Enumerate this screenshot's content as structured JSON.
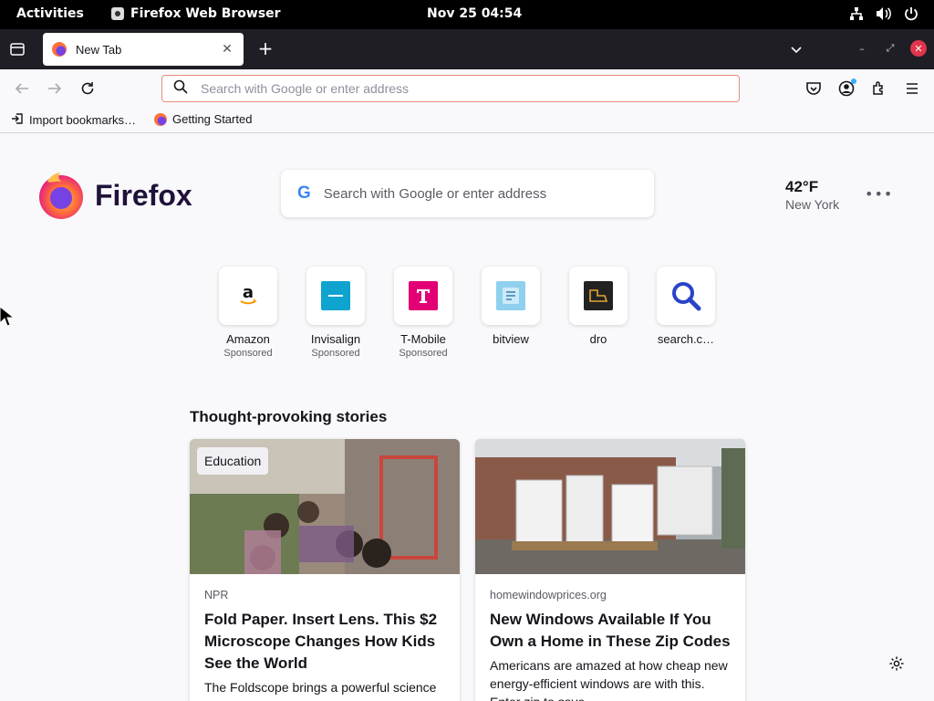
{
  "topbar": {
    "activities": "Activities",
    "app_name": "Firefox Web Browser",
    "clock": "Nov 25  04:54",
    "tray_icons": [
      "network-icon",
      "volume-icon",
      "power-icon"
    ]
  },
  "tabs": [
    {
      "title": "New Tab",
      "active": true
    }
  ],
  "navbar": {
    "url_placeholder": "Search with Google or enter address"
  },
  "bookmarks": [
    {
      "label": "Import bookmarks…",
      "icon": "import-icon"
    },
    {
      "label": "Getting Started",
      "icon": "firefox-icon"
    }
  ],
  "newtab": {
    "brand": "Firefox",
    "search_placeholder": "Search with Google or enter address",
    "weather": {
      "temp": "42°F",
      "city": "New York"
    },
    "top_sites": [
      {
        "label": "Amazon",
        "sponsored": "Sponsored"
      },
      {
        "label": "Invisalign",
        "sponsored": "Sponsored"
      },
      {
        "label": "T-Mobile",
        "sponsored": "Sponsored"
      },
      {
        "label": "bitview",
        "sponsored": ""
      },
      {
        "label": "dro",
        "sponsored": ""
      },
      {
        "label": "search.c…",
        "sponsored": ""
      }
    ],
    "stories_heading": "Thought-provoking stories",
    "stories": [
      {
        "badge": "Education",
        "source": "NPR",
        "headline": "Fold Paper. Insert Lens. This $2 Microscope Changes How Kids See the World",
        "description": "The Foldscope brings a powerful science tool to schools that can't afford"
      },
      {
        "badge": "",
        "source": "homewindowprices.org",
        "headline": "New Windows Available If You Own a Home in These Zip Codes",
        "description": "Americans are amazed at how cheap new energy-efficient windows are with this. Enter zip to save."
      }
    ]
  },
  "colors": {
    "accent": "#e68e7b",
    "tab_strip": "#1f1e25",
    "page_bg": "#f9f9fb",
    "firefox_orange": "#ff7139",
    "firefox_purple": "#7542e5",
    "tmobile_magenta": "#e20074",
    "invisalign_blue": "#0fa3d0"
  }
}
